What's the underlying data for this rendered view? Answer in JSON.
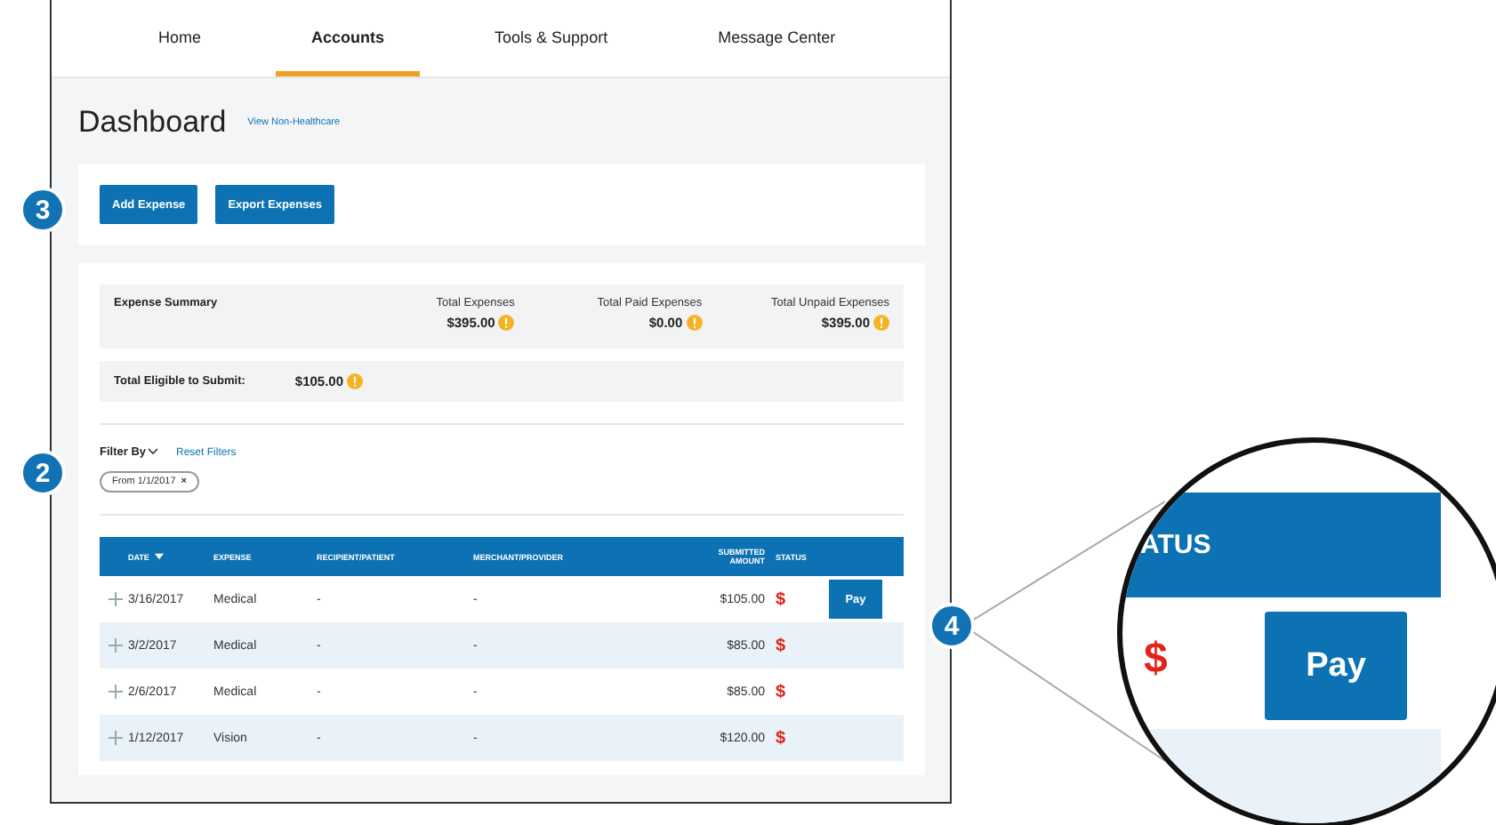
{
  "nav": [
    {
      "label": "Home",
      "selected": false
    },
    {
      "label": "Accounts",
      "selected": true
    },
    {
      "label": "Tools & Support",
      "selected": false
    },
    {
      "label": "Message Center",
      "selected": false
    }
  ],
  "title": "Dashboard",
  "title_link": "View Non-Healthcare",
  "actions": [
    "Add Expense",
    "Export Expenses"
  ],
  "summary": {
    "label": "Expense Summary",
    "totals": [
      {
        "label": "Total Expenses",
        "value": "$395.00"
      },
      {
        "label": "Total Paid Expenses",
        "value": "$0.00"
      },
      {
        "label": "Total Unpaid Expenses",
        "value": "$395.00"
      }
    ]
  },
  "eligible": {
    "label": "Total Eligible to Submit:",
    "value": "$105.00"
  },
  "filter": {
    "label": "Filter By",
    "reset": "Reset Filters",
    "chips": [
      {
        "prefix": "From",
        "value": "1/1/2017",
        "close": "×"
      }
    ]
  },
  "table": {
    "columns": [
      "DATE",
      "EXPENSE",
      "RECIPIENT/PATIENT",
      "MERCHANT/PROVIDER",
      "SUBMITTED AMOUNT",
      "STATUS"
    ],
    "rows": [
      {
        "date": "3/16/2017",
        "expense": "Medical",
        "recipient": "-",
        "merchant": "-",
        "amount": "$105.00",
        "status": "$",
        "action": "Pay"
      },
      {
        "date": "3/2/2017",
        "expense": "Medical",
        "recipient": "-",
        "merchant": "-",
        "amount": "$85.00",
        "status": "$"
      },
      {
        "date": "2/6/2017",
        "expense": "Medical",
        "recipient": "-",
        "merchant": "-",
        "amount": "$85.00",
        "status": "$"
      },
      {
        "date": "1/12/2017",
        "expense": "Vision",
        "recipient": "-",
        "merchant": "-",
        "amount": "$120.00",
        "status": "$"
      }
    ]
  },
  "callouts": [
    "3",
    "2",
    "4"
  ],
  "magnifier": {
    "header": "ATUS",
    "status": "$",
    "action": "Pay"
  }
}
